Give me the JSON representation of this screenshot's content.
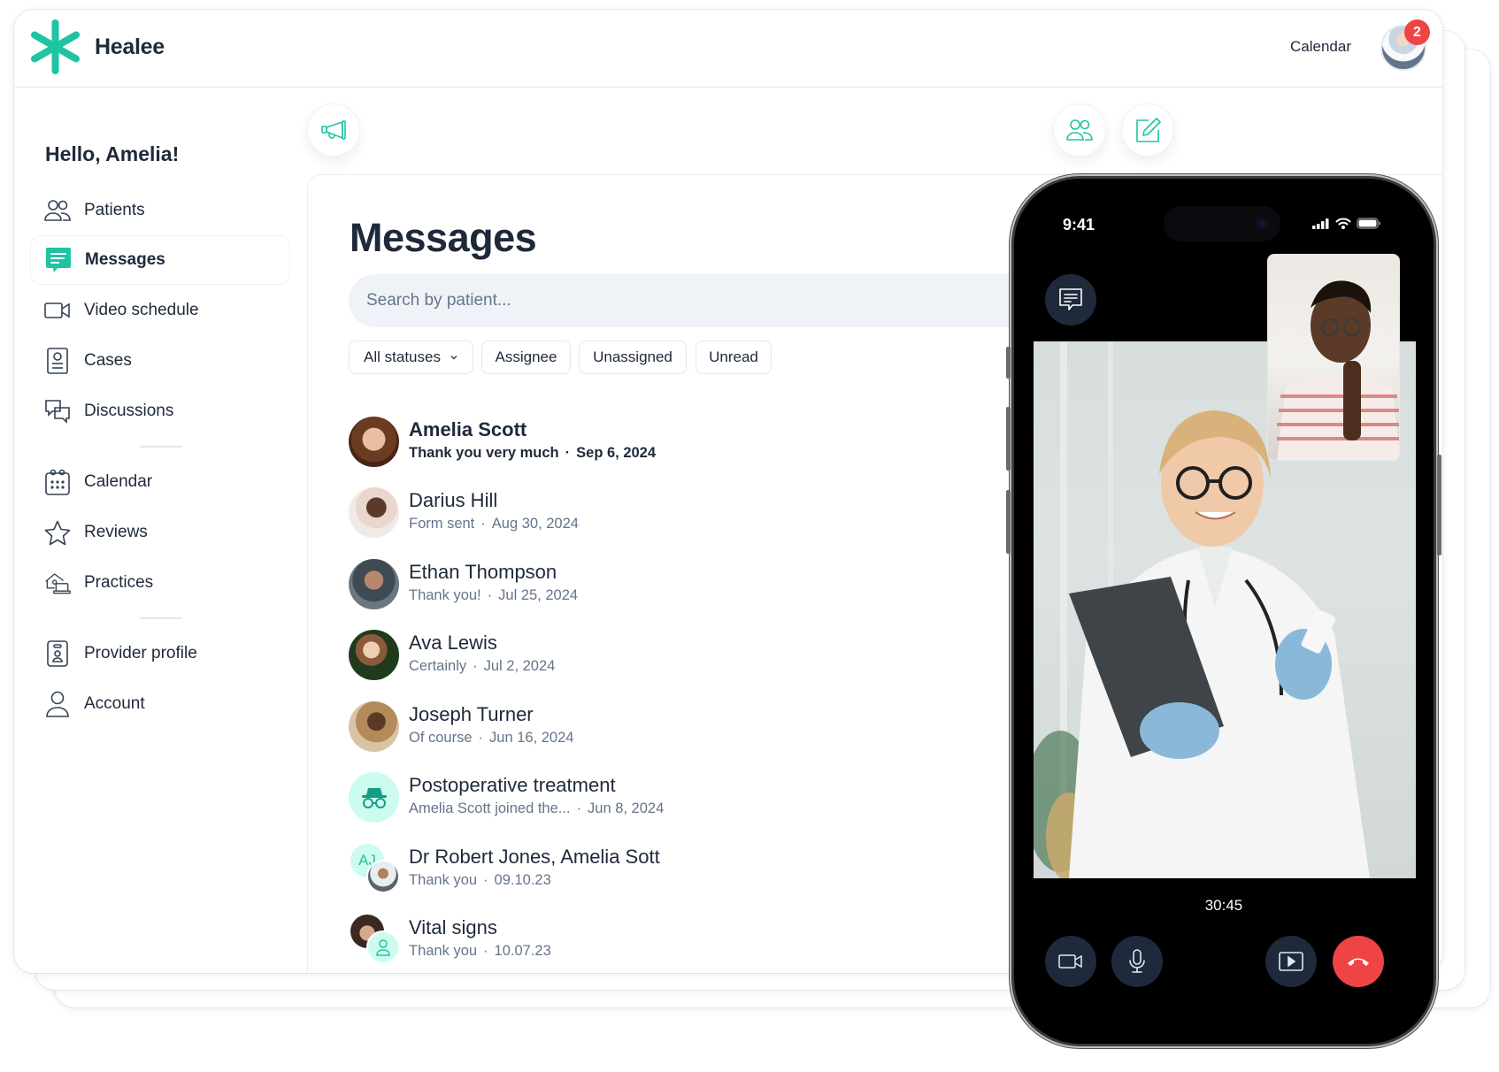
{
  "app": {
    "brand": "Healee",
    "accent_color": "#1fc4a3",
    "danger_color": "#ef4444"
  },
  "header": {
    "calendar_link": "Calendar",
    "notification_count": "2"
  },
  "sidebar": {
    "greeting": "Hello, Amelia!",
    "items": [
      {
        "label": "Patients",
        "icon": "users-icon",
        "active": false
      },
      {
        "label": "Messages",
        "icon": "message-icon",
        "active": true
      },
      {
        "label": "Video schedule",
        "icon": "video-icon",
        "active": false
      },
      {
        "label": "Cases",
        "icon": "case-icon",
        "active": false
      },
      {
        "label": "Discussions",
        "icon": "discussions-icon",
        "active": false
      },
      {
        "label": "Calendar",
        "icon": "calendar-icon",
        "active": false
      },
      {
        "label": "Reviews",
        "icon": "star-icon",
        "active": false
      },
      {
        "label": "Practices",
        "icon": "practices-icon",
        "active": false
      },
      {
        "label": "Provider profile",
        "icon": "badge-icon",
        "active": false
      },
      {
        "label": "Account",
        "icon": "user-icon",
        "active": false
      }
    ]
  },
  "toolbar": {
    "announcements_icon": "megaphone-icon",
    "new_group_icon": "users-icon",
    "compose_icon": "edit-icon"
  },
  "main": {
    "title": "Messages",
    "search": {
      "placeholder": "Search by patient...",
      "value": ""
    },
    "filters": [
      {
        "label": "All statuses",
        "dropdown": true
      },
      {
        "label": "Assignee",
        "dropdown": false
      },
      {
        "label": "Unassigned",
        "dropdown": false
      },
      {
        "label": "Unread",
        "dropdown": false
      }
    ],
    "conversations": [
      {
        "name": "Amelia Scott",
        "preview": "Thank you very much",
        "date": "Sep 6, 2024",
        "unread": true
      },
      {
        "name": "Darius Hill",
        "preview": "Form sent",
        "date": "Aug 30, 2024",
        "unread": false
      },
      {
        "name": "Ethan Thompson",
        "preview": "Thank you!",
        "date": "Jul 25, 2024",
        "unread": false
      },
      {
        "name": "Ava Lewis",
        "preview": "Certainly",
        "date": "Jul 2, 2024",
        "unread": false
      },
      {
        "name": "Joseph Turner",
        "preview": "Of course",
        "date": "Jun 16, 2024",
        "unread": false
      },
      {
        "name": "Postoperative treatment",
        "preview": "Amelia Scott joined the...",
        "date": "Jun 8, 2024",
        "unread": false,
        "avatar": "incognito-icon"
      },
      {
        "name": "Dr Robert Jones, Amelia Sott",
        "preview": "Thank you",
        "date": "09.10.23",
        "unread": false,
        "initials": "AJ"
      },
      {
        "name": "Vital signs",
        "preview": "Thank you",
        "date": "10.07.23",
        "unread": false
      }
    ]
  },
  "phone": {
    "status_time": "9:41",
    "call_timer": "30:45",
    "controls": [
      "camera-icon",
      "microphone-icon",
      "share-screen-icon",
      "end-call-icon"
    ]
  }
}
